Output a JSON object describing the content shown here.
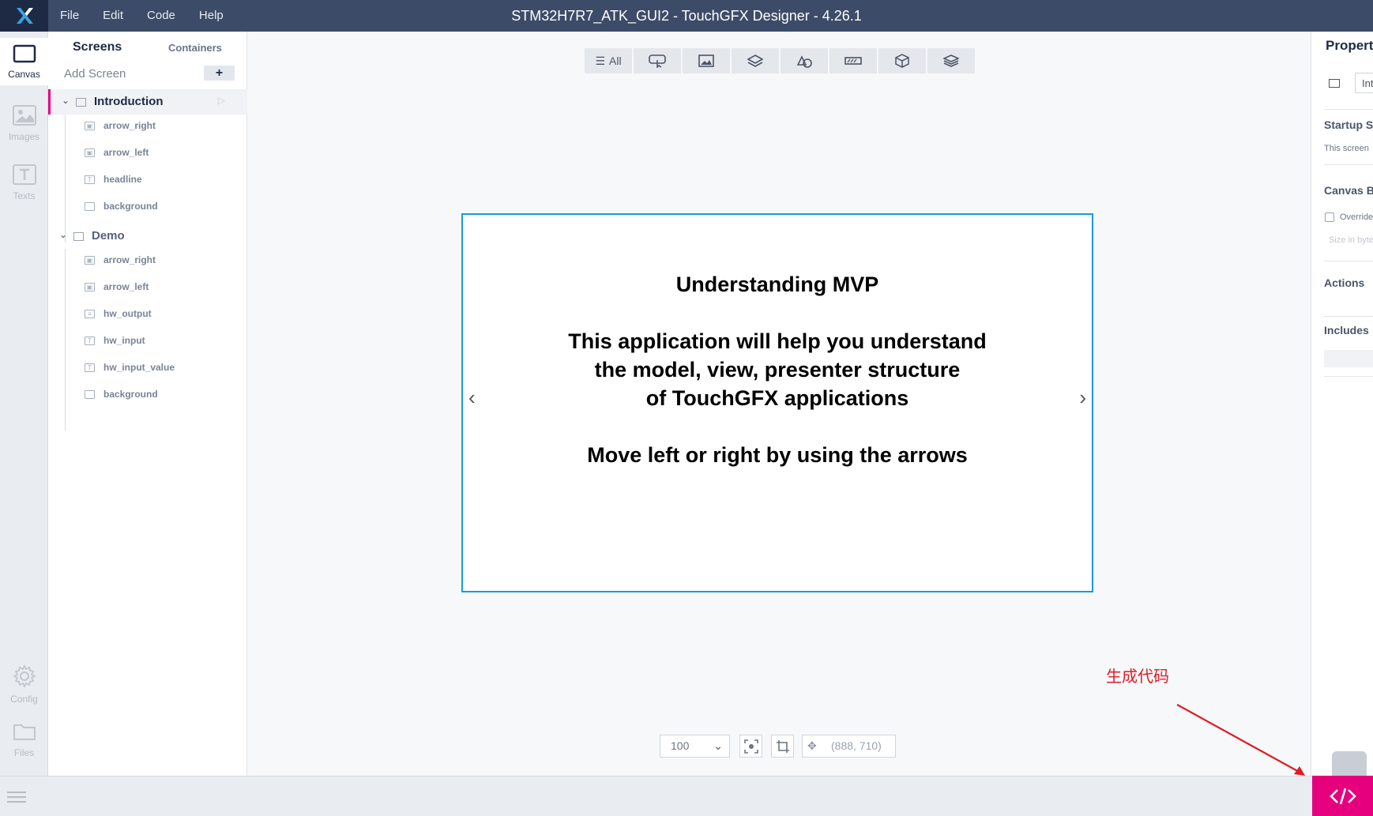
{
  "app": {
    "title": "STM32H7R7_ATK_GUI2 - TouchGFX Designer - 4.26.1",
    "menu": [
      "File",
      "Edit",
      "Code",
      "Help"
    ]
  },
  "rail": {
    "canvas": "Canvas",
    "images": "Images",
    "texts": "Texts",
    "config": "Config",
    "files": "Files"
  },
  "panel": {
    "tab_screens": "Screens",
    "tab_containers": "Containers",
    "add_screen": "Add Screen",
    "add_symbol": "+",
    "screens": [
      {
        "name": "Introduction",
        "widgets": [
          "arrow_right",
          "arrow_left",
          "headline",
          "background"
        ]
      },
      {
        "name": "Demo",
        "widgets": [
          "arrow_right",
          "arrow_left",
          "hw_output",
          "hw_input",
          "hw_input_value",
          "background"
        ]
      }
    ]
  },
  "toolbar": {
    "all_label": "All"
  },
  "stage": {
    "line1": "Understanding MVP",
    "line2": "This application will help you understand",
    "line3": "the model, view, presenter structure",
    "line4": "of TouchGFX applications",
    "line5": "Move left or right by using the arrows"
  },
  "annotation": "生成代码",
  "zoom": {
    "value": "100",
    "coords": "(888, 710)"
  },
  "props": {
    "title": "Properties",
    "field": "Int",
    "startup": "Startup Screen",
    "startup_desc": "This screen",
    "canvas_buffer": "Canvas Buffer",
    "override": "Override",
    "size": "Size in bytes",
    "actions": "Actions",
    "includes": "Includes"
  },
  "colors": {
    "titlebar": "#3c4c68",
    "accent": "#e6007e",
    "stage_border": "#1a9ad6",
    "annotation": "#e01b24"
  }
}
